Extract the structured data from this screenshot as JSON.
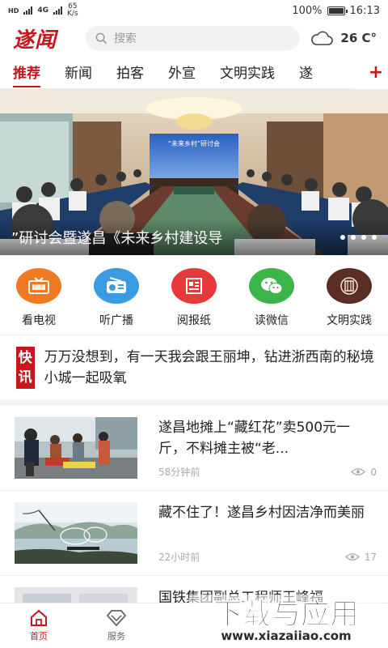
{
  "status_bar": {
    "network_left": "HD",
    "network_type": "4G",
    "speed_value": "65",
    "speed_unit": "K/s",
    "battery": "100%",
    "time": "16:13"
  },
  "header": {
    "logo": "遂闻",
    "search_placeholder": "搜索",
    "temperature": "26 C°",
    "weather_icon": "cloud-icon"
  },
  "tabs": [
    {
      "label": "推荐",
      "active": true
    },
    {
      "label": "新闻"
    },
    {
      "label": "拍客"
    },
    {
      "label": "外宣"
    },
    {
      "label": "文明实践"
    },
    {
      "label": "遂"
    }
  ],
  "tab_more": "+",
  "banner": {
    "caption": "”研讨会暨遂昌《未来乡村建设导",
    "screen_title": "“未来乡村”研讨会"
  },
  "quick_links": [
    {
      "label": "看电视",
      "icon": "tv-icon",
      "color": "#f07a23"
    },
    {
      "label": "听广播",
      "icon": "radio-icon",
      "color": "#3b9be0"
    },
    {
      "label": "阅报纸",
      "icon": "newspaper-icon",
      "color": "#e8393a"
    },
    {
      "label": "读微信",
      "icon": "wechat-icon",
      "color": "#3bb449"
    },
    {
      "label": "文明实践",
      "icon": "civilization-icon",
      "color": "#5a2e22"
    }
  ],
  "flash": {
    "badge_top": "快",
    "badge_bottom": "讯",
    "text": "万万没想到，有一天我会跟王丽坤，钻进浙西南的秘境小城一起吸氧"
  },
  "news": [
    {
      "title": "遂昌地摊上“藏红花”卖500元一斤，不料摊主被“老...",
      "time": "58分钟前",
      "views": "0"
    },
    {
      "title": "藏不住了！遂昌乡村因洁净而美丽",
      "time": "22小时前",
      "views": "17"
    },
    {
      "title": "国铁集团副总工程师王峰福"
    }
  ],
  "bottom_nav": [
    {
      "label": "首页",
      "icon": "home-icon",
      "active": true
    },
    {
      "label": "服务",
      "icon": "diamond-icon"
    }
  ],
  "watermark": {
    "brand": "下载与应用",
    "url": "www.xiazaiiao.com"
  },
  "colors": {
    "accent": "#c8161d"
  }
}
